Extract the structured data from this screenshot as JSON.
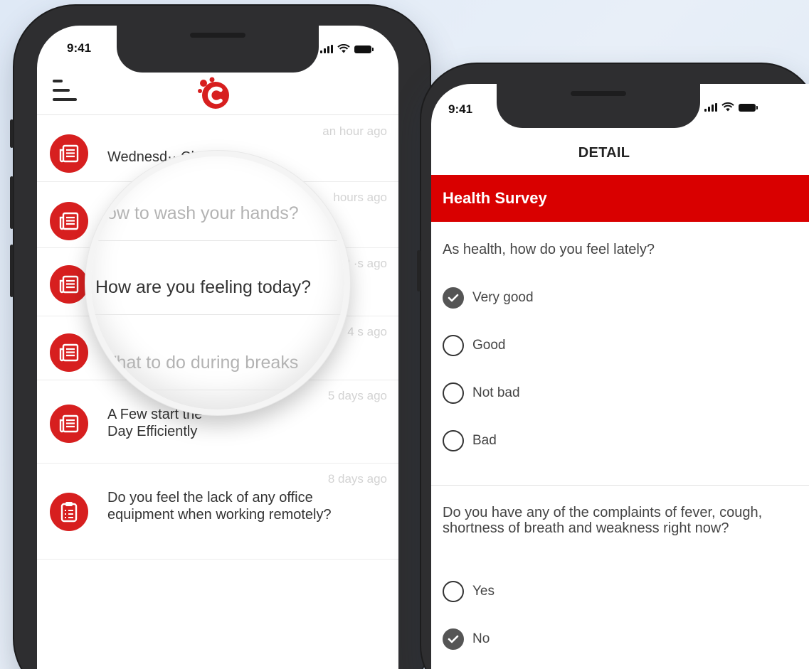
{
  "colors": {
    "accent": "#d90000",
    "icon_red": "#d71f1f",
    "timestamp": "#d3d3d3"
  },
  "left_phone": {
    "status": {
      "time": "9:41"
    },
    "feed": [
      {
        "time": "an hour ago",
        "title": "Wednesd·· Ch···tsl",
        "icon": "newspaper-icon"
      },
      {
        "time": "hours ago",
        "title": "",
        "icon": "newspaper-icon"
      },
      {
        "time": "2 ·s ago",
        "title": "",
        "icon": "newspaper-icon"
      },
      {
        "time": "4  s ago",
        "title": "",
        "icon": "newspaper-icon"
      },
      {
        "time": "5 days ago",
        "title": "A Few                 start the\nDay Efficiently",
        "icon": "newspaper-icon"
      },
      {
        "time": "8 days ago",
        "title": "Do you feel the lack of any office equipment when working remotely?",
        "icon": "clipboard-icon"
      }
    ],
    "magnifier": {
      "line1": "How to wash your hands?",
      "line2": "How are you feeling today?",
      "line3": "What to do during breaks"
    }
  },
  "right_phone": {
    "status": {
      "time": "9:41"
    },
    "header": "DETAIL",
    "survey_title": "Health Survey",
    "q1": {
      "text": "As health, how do you feel lately?",
      "options": [
        {
          "label": "Very good",
          "checked": true
        },
        {
          "label": "Good",
          "checked": false
        },
        {
          "label": "Not bad",
          "checked": false
        },
        {
          "label": "Bad",
          "checked": false
        }
      ]
    },
    "q2": {
      "text": "Do you have any of the complaints of fever, cough, shortness of breath and weakness right now?",
      "options": [
        {
          "label": "Yes",
          "checked": false
        },
        {
          "label": "No",
          "checked": true
        }
      ]
    }
  }
}
